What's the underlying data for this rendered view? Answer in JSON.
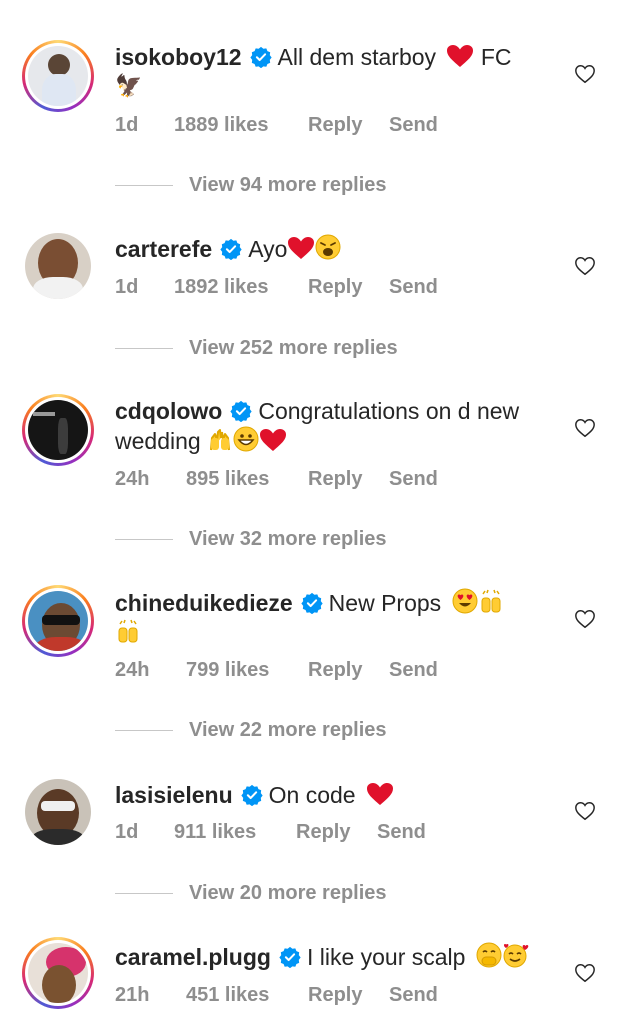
{
  "comments": [
    {
      "username": "isokoboy12",
      "text_before": "All dem starboy",
      "text_after": "FC",
      "line2": "🦅",
      "time": "1d",
      "likes": "1889 likes",
      "reply_label": "Reply",
      "send_label": "Send",
      "view_replies": "View 94 more replies"
    },
    {
      "username": "carterefe",
      "text_before": "Ayo",
      "time": "1d",
      "likes": "1892 likes",
      "reply_label": "Reply",
      "send_label": "Send",
      "view_replies": "View 252 more replies"
    },
    {
      "username": "cdqolowo",
      "text_before": "Congratulations on d new",
      "line2": "wedding",
      "time": "24h",
      "likes": "895 likes",
      "reply_label": "Reply",
      "send_label": "Send",
      "view_replies": "View 32 more replies"
    },
    {
      "username": "chineduikedieze",
      "text_before": "New Props",
      "time": "24h",
      "likes": "799 likes",
      "reply_label": "Reply",
      "send_label": "Send",
      "view_replies": "View 22 more replies"
    },
    {
      "username": "lasisielenu",
      "text_before": "On code",
      "time": "1d",
      "likes": "911 likes",
      "reply_label": "Reply",
      "send_label": "Send",
      "view_replies": "View 20 more replies"
    },
    {
      "username": "caramel.plugg",
      "text_before": "I like your scalp",
      "time": "21h",
      "likes": "451 likes",
      "reply_label": "Reply",
      "send_label": "Send"
    }
  ],
  "colors": {
    "verified": "#0095f6",
    "heart_emoji": "#e0112b",
    "meta_text": "#8e8e8e"
  }
}
